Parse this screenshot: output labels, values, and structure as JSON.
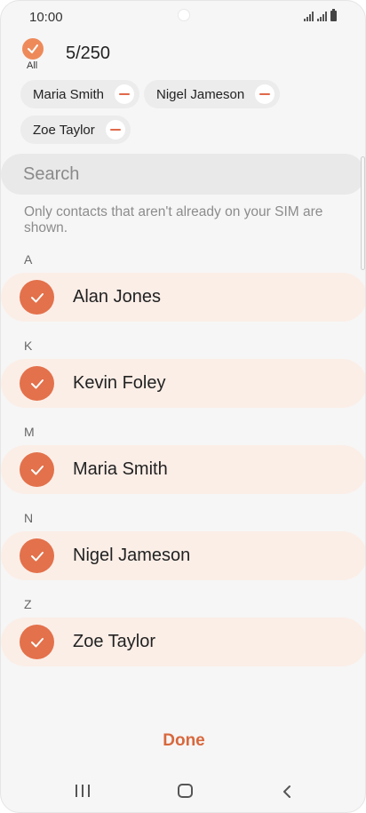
{
  "status_bar": {
    "time": "10:00"
  },
  "header": {
    "all_label": "All",
    "count": "5/250"
  },
  "chips": [
    {
      "label": "Maria Smith"
    },
    {
      "label": "Nigel Jameson"
    },
    {
      "label": "Zoe Taylor"
    }
  ],
  "search": {
    "placeholder": "Search"
  },
  "info_text": "Only contacts that aren't already on your SIM are shown.",
  "sections": [
    {
      "letter": "A",
      "contact": "Alan Jones"
    },
    {
      "letter": "K",
      "contact": "Kevin Foley"
    },
    {
      "letter": "M",
      "contact": "Maria Smith"
    },
    {
      "letter": "N",
      "contact": "Nigel Jameson"
    },
    {
      "letter": "Z",
      "contact": "Zoe Taylor"
    }
  ],
  "done_label": "Done",
  "colors": {
    "accent": "#e3714b",
    "selected_row": "#fbeee7",
    "done_text": "#d8683d"
  }
}
